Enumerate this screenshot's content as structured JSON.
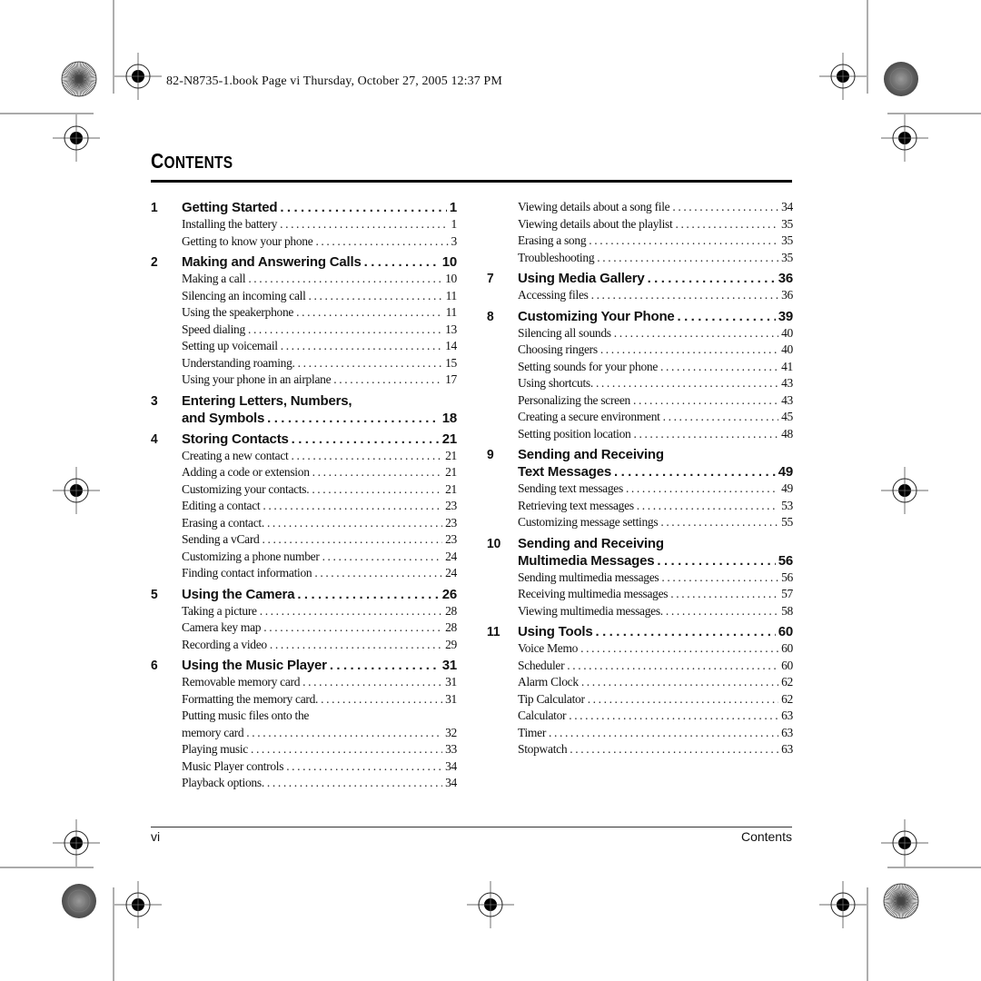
{
  "slug_line": "82-N8735-1.book  Page vi  Thursday, October 27, 2005  12:37 PM",
  "page_title": {
    "first_letter": "C",
    "rest": "ONTENTS"
  },
  "footer": {
    "page_number": "vi",
    "section": "Contents"
  },
  "dot_leader": "...............................................................................",
  "toc": {
    "left_column": [
      {
        "number": "1",
        "title": "Getting Started",
        "page": "1",
        "entries": [
          {
            "label": "Installing the battery",
            "page": "1"
          },
          {
            "label": "Getting to know your phone",
            "page": "3"
          }
        ]
      },
      {
        "number": "2",
        "title": "Making and Answering Calls",
        "page": "10",
        "entries": [
          {
            "label": "Making a call",
            "page": "10"
          },
          {
            "label": "Silencing an incoming call",
            "page": "11"
          },
          {
            "label": "Using the speakerphone",
            "page": "11"
          },
          {
            "label": "Speed dialing",
            "page": "13"
          },
          {
            "label": "Setting up voicemail",
            "page": "14"
          },
          {
            "label": "Understanding roaming.",
            "page": "15"
          },
          {
            "label": "Using your phone in an airplane",
            "page": "17"
          }
        ]
      },
      {
        "number": "3",
        "title_line1": "Entering Letters, Numbers,",
        "title": "and Symbols",
        "page": "18",
        "entries": []
      },
      {
        "number": "4",
        "title": "Storing Contacts",
        "page": "21",
        "entries": [
          {
            "label": "Creating a new contact",
            "page": "21"
          },
          {
            "label": "Adding a code or extension",
            "page": "21"
          },
          {
            "label": "Customizing your contacts.",
            "page": "21"
          },
          {
            "label": "Editing a contact",
            "page": "23"
          },
          {
            "label": "Erasing a contact.",
            "page": "23"
          },
          {
            "label": "Sending a vCard",
            "page": "23"
          },
          {
            "label": "Customizing a phone number",
            "page": "24"
          },
          {
            "label": "Finding contact information",
            "page": "24"
          }
        ]
      },
      {
        "number": "5",
        "title": "Using the Camera",
        "page": "26",
        "entries": [
          {
            "label": "Taking a picture",
            "page": "28"
          },
          {
            "label": "Camera key map",
            "page": "28"
          },
          {
            "label": "Recording a video",
            "page": "29"
          }
        ]
      },
      {
        "number": "6",
        "title": "Using the Music Player",
        "page": "31",
        "entries": [
          {
            "label": "Removable memory card",
            "page": "31"
          },
          {
            "label": "Formatting the memory card.",
            "page": "31"
          },
          {
            "label_line1": "Putting music files onto the",
            "label": "memory card",
            "page": "32"
          },
          {
            "label": "Playing music",
            "page": "33"
          },
          {
            "label": "Music Player controls",
            "page": "34"
          },
          {
            "label": "Playback options.",
            "page": "34"
          }
        ]
      }
    ],
    "right_column_continued": [
      {
        "label": "Viewing details about a song file",
        "page": "34"
      },
      {
        "label": "Viewing details about the playlist",
        "page": "35"
      },
      {
        "label": "Erasing a song",
        "page": "35"
      },
      {
        "label": "Troubleshooting",
        "page": "35"
      }
    ],
    "right_column": [
      {
        "number": "7",
        "title": "Using Media Gallery",
        "page": "36",
        "entries": [
          {
            "label": "Accessing files",
            "page": "36"
          }
        ]
      },
      {
        "number": "8",
        "title": "Customizing Your Phone",
        "page": "39",
        "entries": [
          {
            "label": "Silencing all sounds",
            "page": "40"
          },
          {
            "label": "Choosing ringers",
            "page": "40"
          },
          {
            "label": "Setting sounds for your phone",
            "page": "41"
          },
          {
            "label": "Using shortcuts.",
            "page": "43"
          },
          {
            "label": "Personalizing the screen",
            "page": "43"
          },
          {
            "label": "Creating a secure environment",
            "page": "45"
          },
          {
            "label": "Setting position location",
            "page": "48"
          }
        ]
      },
      {
        "number": "9",
        "title_line1": "Sending and Receiving",
        "title": "Text Messages",
        "page": "49",
        "entries": [
          {
            "label": "Sending text messages",
            "page": "49"
          },
          {
            "label": "Retrieving text messages",
            "page": "53"
          },
          {
            "label": "Customizing message settings",
            "page": "55"
          }
        ]
      },
      {
        "number": "10",
        "title_line1": "Sending and Receiving",
        "title": "Multimedia Messages",
        "page": "56",
        "entries": [
          {
            "label": "Sending multimedia messages",
            "page": "56"
          },
          {
            "label": "Receiving multimedia messages",
            "page": "57"
          },
          {
            "label": "Viewing multimedia messages.",
            "page": "58"
          }
        ]
      },
      {
        "number": "11",
        "title": "Using Tools",
        "page": "60",
        "entries": [
          {
            "label": "Voice Memo",
            "page": "60"
          },
          {
            "label": "Scheduler",
            "page": "60"
          },
          {
            "label": "Alarm Clock",
            "page": "62"
          },
          {
            "label": "Tip Calculator",
            "page": "62"
          },
          {
            "label": "Calculator",
            "page": "63"
          },
          {
            "label": "Timer",
            "page": "63"
          },
          {
            "label": "Stopwatch",
            "page": "63"
          }
        ]
      }
    ]
  }
}
